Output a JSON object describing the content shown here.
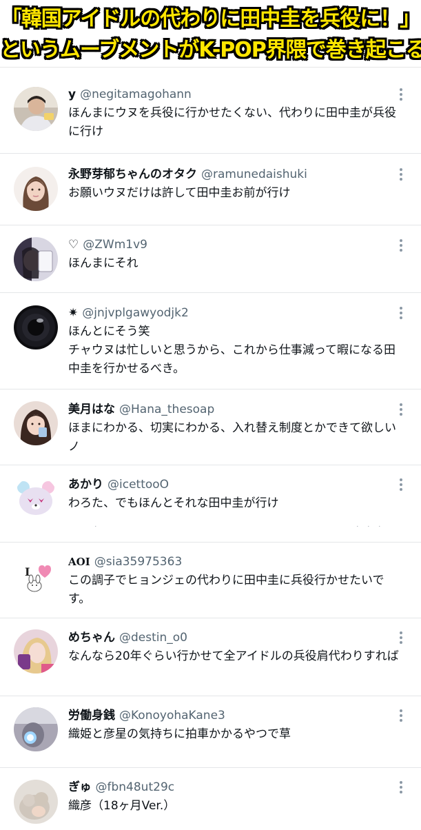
{
  "banner": {
    "line1": "「韓国アイドルの代わりに田中圭を兵役に！」",
    "line2": "というムーブメントがK-POP界隈で巻き起こる",
    "text_color": "#ffe600",
    "outline_color": "#000000"
  },
  "tweets": [
    {
      "name": "y",
      "handle": "@negitamagohann",
      "body": "ほんまにウヌを兵役に行かせたくない、代わりに田中圭が兵役に行け",
      "avatar": "photo-person-avatar"
    },
    {
      "name": "永野芽郁ちゃんのオタク",
      "handle": "@ramunedaishuki",
      "body": "お願いウヌだけは許して田中圭お前が行け",
      "avatar": "photo-woman-avatar"
    },
    {
      "name": "♡",
      "handle": "@ZWm1v9",
      "body": "ほんまにそれ",
      "avatar": "photo-avatar"
    },
    {
      "name": "✷",
      "handle": "@jnjvplgawyodjk2",
      "body": "ほんとにそう笑\nチャウヌは忙しいと思うから、これから仕事減って暇になる田中圭を行かせるべき。",
      "avatar": "dark-sphere-avatar"
    },
    {
      "name": "美月はな",
      "handle": "@Hana_thesoap",
      "body": "ほまにわかる、切実にわかる、入れ替え制度とかできて欲しいノ",
      "avatar": "photo-girl-avatar"
    },
    {
      "name": "あかり",
      "handle": "@icettooO",
      "body": "わろた、でもほんとそれな田中圭が行け",
      "avatar": "bear-character-avatar"
    },
    {
      "name": "AOI",
      "handle": "@sia35975363",
      "body": "この調子でヒョンジェの代わりに田中圭に兵役行かせたいです。",
      "avatar": "i-love-bunny-avatar"
    },
    {
      "name": "めちゃん",
      "handle": "@destin_o0",
      "body": "なんなら20年ぐらい行かせて全アイドルの兵役肩代わりすれば",
      "avatar": "photo-blonde-avatar"
    },
    {
      "name": "労働身銭",
      "handle": "@KonoyohaKane3",
      "body": "織姫と彦星の気持ちに拍車かかるやつで草",
      "avatar": "photo-light-avatar"
    },
    {
      "name": "ぎゅ",
      "handle": "@fbn48ut29c",
      "body": "織彦（18ヶ月Ver.）",
      "avatar": "photo-plush-avatar"
    }
  ]
}
